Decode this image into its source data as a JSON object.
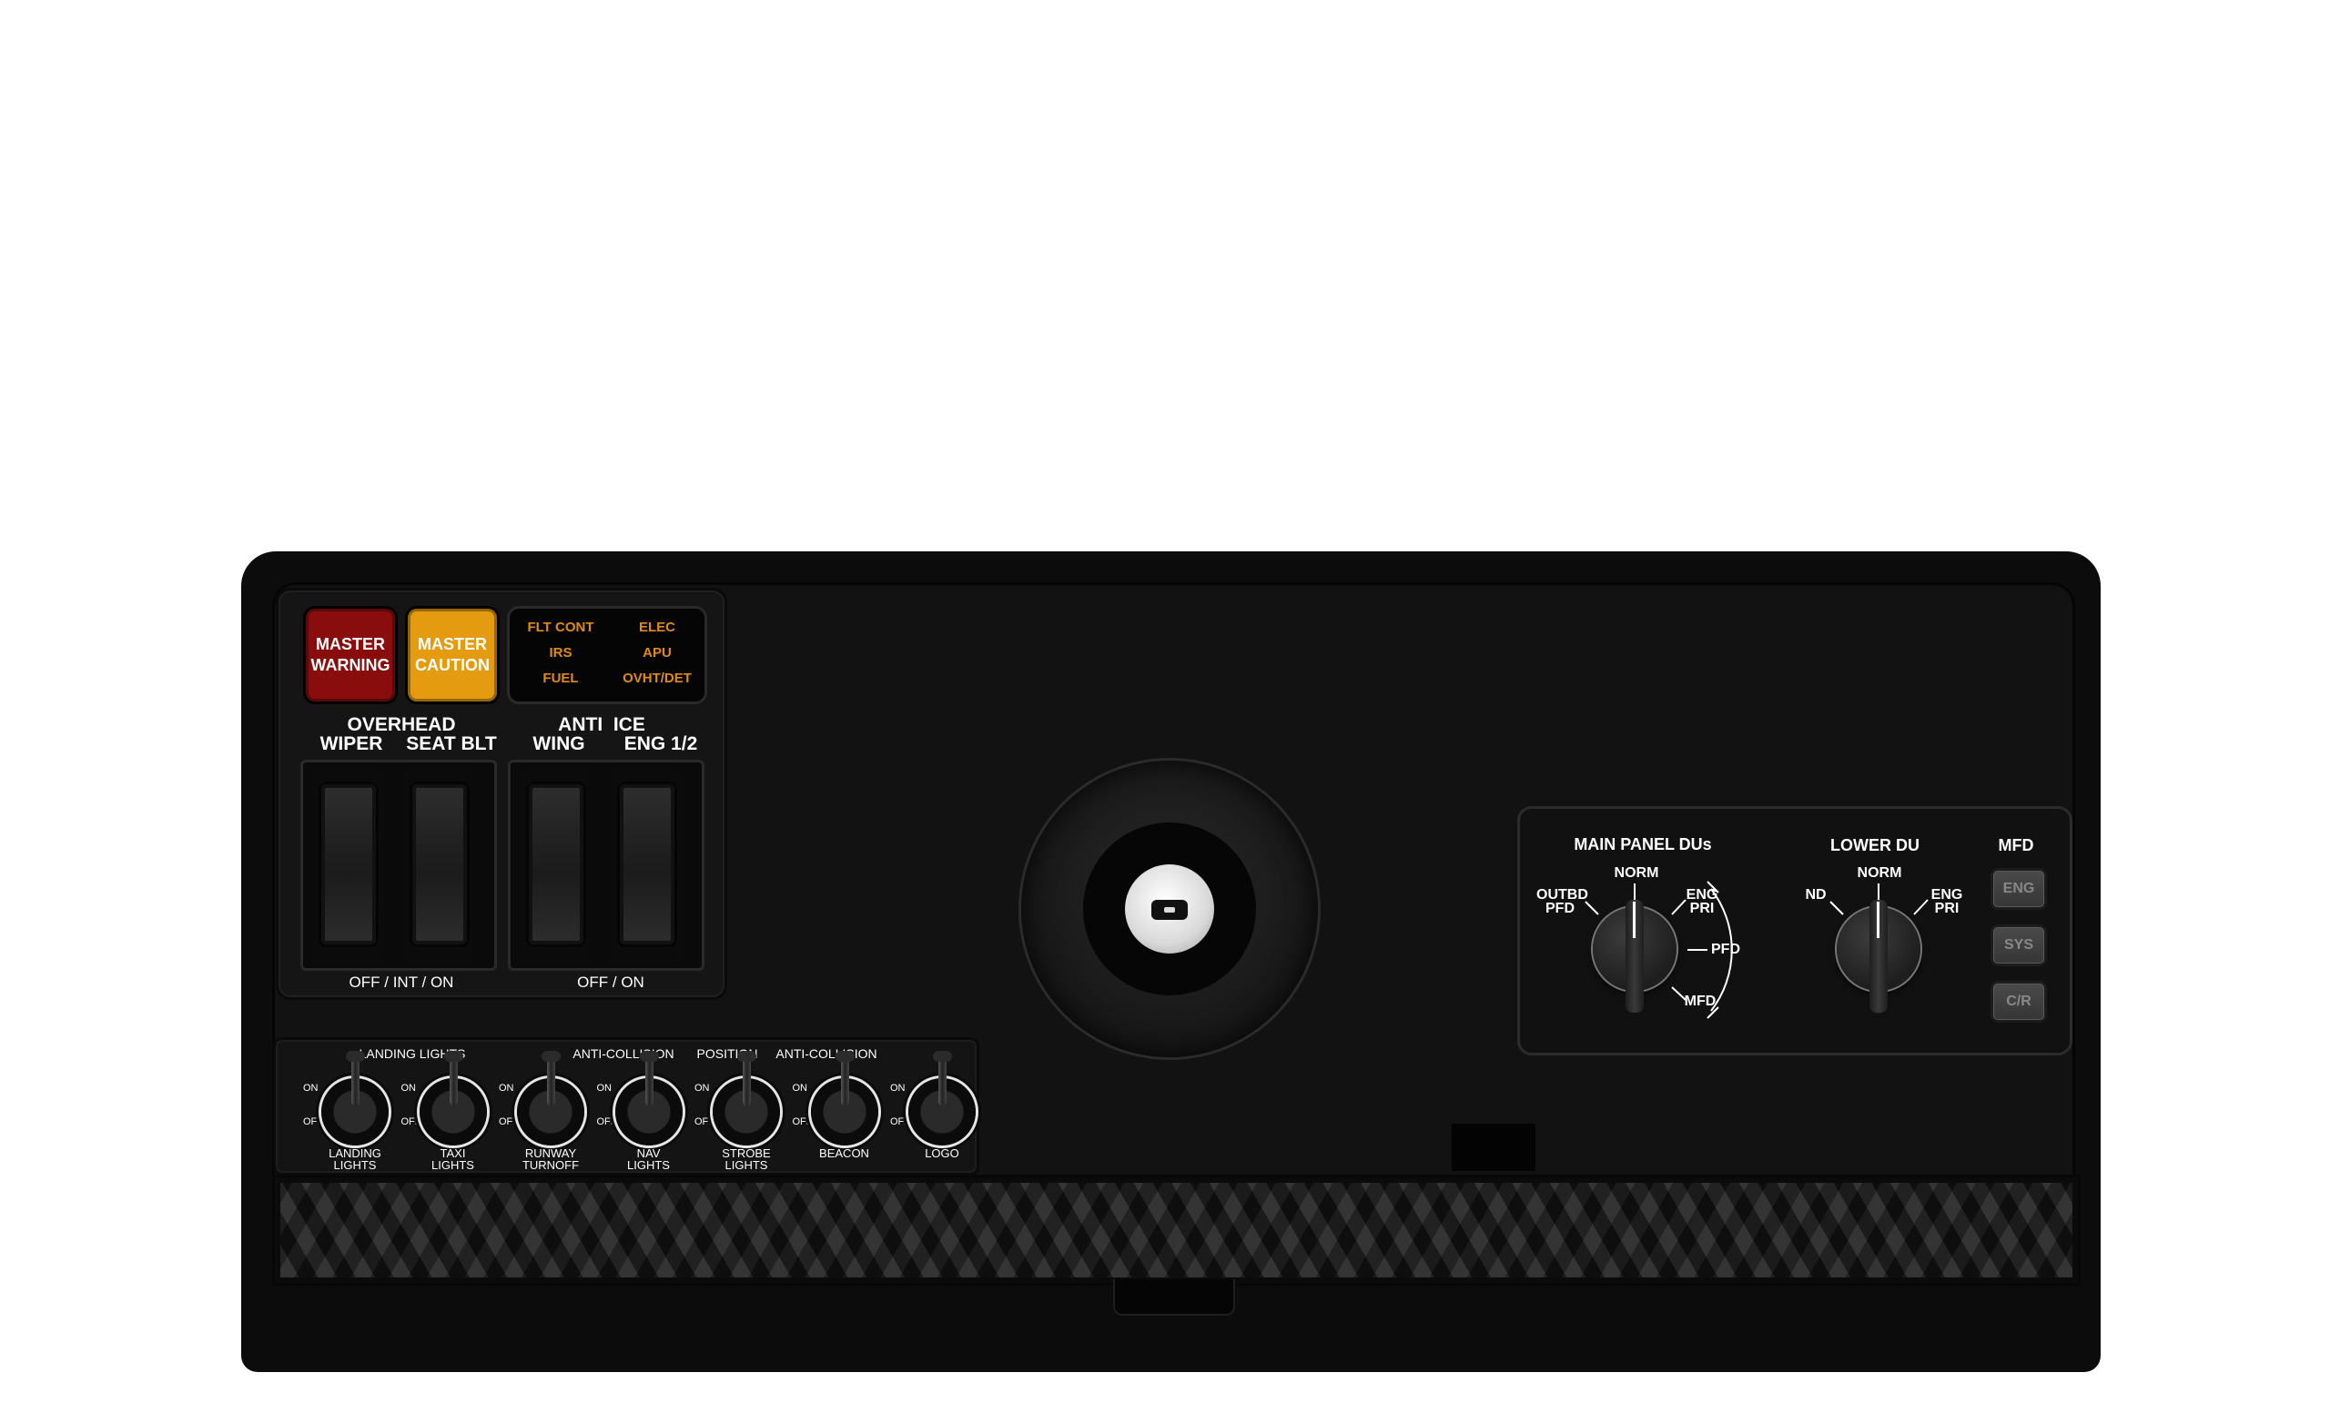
{
  "annunciators": {
    "master_warning": [
      "MASTER",
      "WARNING"
    ],
    "master_caution": [
      "MASTER",
      "CAUTION"
    ],
    "systems": [
      "FLT CONT",
      "ELEC",
      "IRS",
      "APU",
      "FUEL",
      "OVHT/DET"
    ],
    "colors": {
      "warning": "#8a0d0d",
      "caution": "#e49b10",
      "system_text": "#e08a18"
    }
  },
  "switch_groups": {
    "overhead": {
      "title": "OVERHEAD",
      "switches": [
        "WIPER",
        "SEAT BLT"
      ],
      "positions": "OFF / INT / ON"
    },
    "anti_ice": {
      "title": "ANTI  ICE",
      "switches": [
        "WING",
        "ENG 1/2"
      ],
      "positions": "OFF / ON"
    }
  },
  "toggle_strip": {
    "group_labels": [
      "LANDING LIGHTS",
      "ANTI-COLLISION",
      "POSITION",
      "ANTI-COLLISION"
    ],
    "on_label": "ON",
    "off_label": "OFF",
    "toggles": [
      [
        "LANDING",
        "LIGHTS"
      ],
      [
        "TAXI",
        "LIGHTS"
      ],
      [
        "RUNWAY",
        "TURNOFF"
      ],
      [
        "NAV",
        "LIGHTS"
      ],
      [
        "STROBE",
        "LIGHTS"
      ],
      [
        "BEACON"
      ],
      [
        "LOGO"
      ]
    ]
  },
  "display_select": {
    "main_panel": {
      "title": "MAIN PANEL DUs",
      "positions": [
        "OUTBD",
        "PFD",
        "NORM",
        "ENG",
        "PRI",
        "PFD",
        "MFD"
      ],
      "selected": "NORM"
    },
    "lower_du": {
      "title": "LOWER DU",
      "positions": [
        "ND",
        "NORM",
        "ENG",
        "PRI"
      ],
      "selected": "NORM"
    },
    "mfd": {
      "title": "MFD",
      "buttons": [
        "ENG",
        "SYS",
        "C/R"
      ]
    }
  },
  "center_knob": {
    "icon": "keylock-icon"
  }
}
